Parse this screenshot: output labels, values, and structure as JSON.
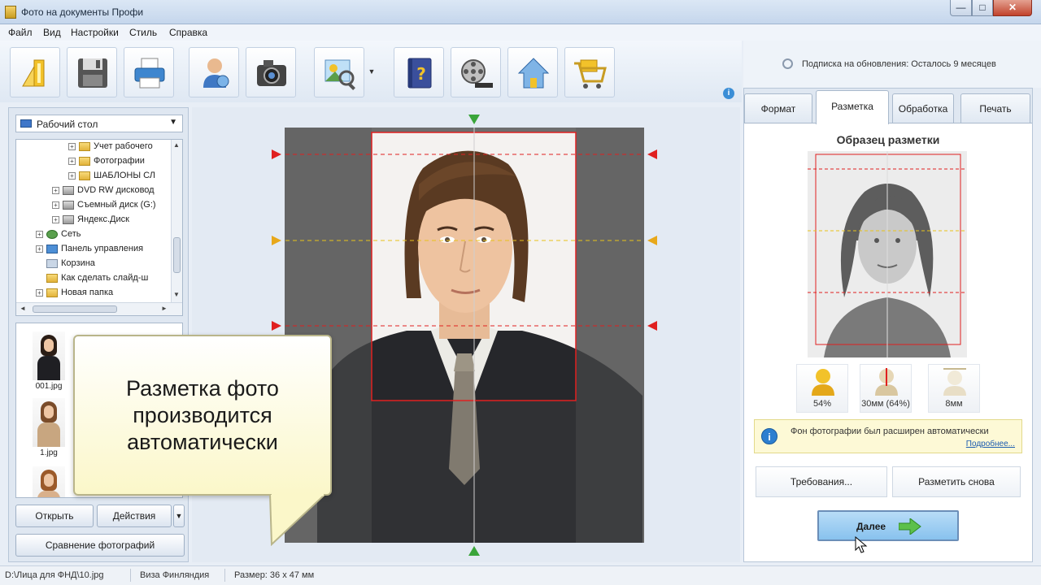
{
  "window": {
    "title": "Фото на документы Профи"
  },
  "menu": [
    "Файл",
    "Вид",
    "Настройки",
    "Стиль",
    "Справка"
  ],
  "toolbar": {
    "buttons": [
      "wizard-icon",
      "save-icon",
      "print-icon",
      "contacts-icon",
      "camera-icon",
      "image-editor-icon",
      "help-book-icon",
      "film-icon",
      "home-icon",
      "cart-icon"
    ]
  },
  "subscription": {
    "text": "Подписка на обновления: Осталось 9 месяцев"
  },
  "folder_select": {
    "value": "Рабочий стол"
  },
  "tree": [
    {
      "label": "Учет рабочего",
      "icon": "folder"
    },
    {
      "label": "Фотографии",
      "icon": "folder"
    },
    {
      "label": "ШАБЛОНЫ СЛ",
      "icon": "folder"
    },
    {
      "label": "DVD RW дисковод",
      "icon": "drive"
    },
    {
      "label": "Съемный диск (G:)",
      "icon": "drive"
    },
    {
      "label": "Яндекс.Диск",
      "icon": "drive"
    },
    {
      "label": "Сеть",
      "icon": "net"
    },
    {
      "label": "Панель управления",
      "icon": "panel"
    },
    {
      "label": "Корзина",
      "icon": "trash"
    },
    {
      "label": "Как сделать слайд-ш",
      "icon": "folder"
    },
    {
      "label": "Новая папка",
      "icon": "folder"
    }
  ],
  "thumbnails": [
    {
      "name": "001.jpg",
      "hair": "#2a1d15",
      "body": "#1f1f23"
    },
    {
      "name": "1.jpg",
      "hair": "#7a4c2a",
      "body": "#c8a680"
    },
    {
      "name": "",
      "hair": "#9b5a2a",
      "body": "#d9b08b"
    }
  ],
  "left_buttons": {
    "open": "Открыть",
    "actions": "Действия",
    "actions_more": "▼",
    "compare": "Сравнение фотографий"
  },
  "callout": {
    "lines": [
      "Разметка фото",
      "производится",
      "автоматически"
    ]
  },
  "tabs": [
    {
      "label": "Формат",
      "active": false
    },
    {
      "label": "Разметка",
      "active": true
    },
    {
      "label": "Обработка",
      "active": false
    },
    {
      "label": "Печать",
      "active": false
    }
  ],
  "markup_panel": {
    "title": "Образец разметки",
    "metrics": [
      {
        "icon": "head-height-icon",
        "value": "54%"
      },
      {
        "icon": "face-height-icon",
        "value": "30мм (64%)"
      },
      {
        "icon": "margin-icon",
        "value": "8мм"
      }
    ],
    "notice": {
      "text": "Фон фотографии был расширен автоматически",
      "link": "Подробнее..."
    },
    "requirements_button": "Требования...",
    "remark_button": "Разметить снова",
    "next_button": "Далее"
  },
  "status": {
    "path": "D:\\Лица для ФНД\\10.jpg",
    "format": "Виза Финляндия",
    "size": "Размер: 36 x 47 мм"
  },
  "colors": {
    "accent": "#88c2ee",
    "guide_red": "#e02020",
    "guide_yellow": "#e8c21a",
    "guide_green": "#3aa53a",
    "callout_bg": "#fbf7c9"
  }
}
